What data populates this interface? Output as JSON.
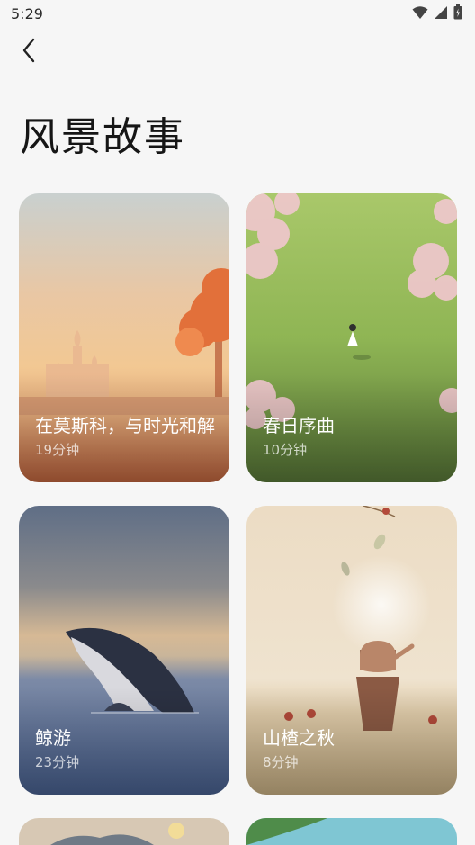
{
  "status_bar": {
    "time": "5:29",
    "icons": [
      "wifi-icon",
      "signal-icon",
      "battery-icon"
    ]
  },
  "header": {
    "back_icon": "chevron-left-icon",
    "title": "风景故事"
  },
  "cards": [
    {
      "title": "在莫斯科，与时光和解",
      "duration": "19分钟"
    },
    {
      "title": "春日序曲",
      "duration": "10分钟"
    },
    {
      "title": "鲸游",
      "duration": "23分钟"
    },
    {
      "title": "山楂之秋",
      "duration": "8分钟"
    }
  ],
  "colors": {
    "background": "#f6f6f6",
    "text_primary": "#161616",
    "card_text": "#ffffff"
  }
}
